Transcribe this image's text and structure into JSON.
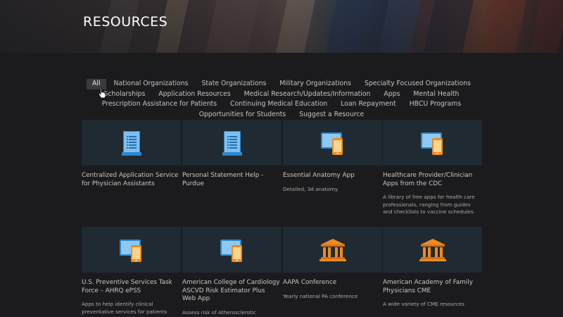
{
  "header": {
    "title": "RESOURCES"
  },
  "filters": [
    "All",
    "National Organizations",
    "State Organizations",
    "Military Organizations",
    "Specialty Focused Organizations",
    "Scholarships",
    "Application Resources",
    "Medical Research/Updates/Information",
    "Apps",
    "Mental Health",
    "Prescription Assistance for Patients",
    "Continuing Medical Education",
    "Loan Repayment",
    "HBCU Programs",
    "Opportunities for Students",
    "Suggest a Resource"
  ],
  "active_filter": "All",
  "cards": [
    {
      "icon": "document-icon",
      "title": "Centralized Application Service for Physician Assistants",
      "desc": ""
    },
    {
      "icon": "document-icon",
      "title": "Personal Statement Help - Purdue",
      "desc": ""
    },
    {
      "icon": "devices-icon",
      "title": "Essential Anatomy App",
      "desc": "Detailed, 3d anatomy."
    },
    {
      "icon": "devices-icon",
      "title": "Healthcare Provider/Clinician Apps from the CDC",
      "desc": "A library of free apps for health care professionals, ranging from guides and checklists to vaccine schedules."
    },
    {
      "icon": "devices-icon",
      "title": "U.S. Preventive Services Task Force – AHRQ ePSS",
      "desc": "Apps to help identify clinical preventative services for patients"
    },
    {
      "icon": "devices-icon",
      "title": "American College of Cardiology ASCVD Risk Estimator Plus Web App",
      "desc": "Assess risk of Atherosclerotic Cardiovascular Disease"
    },
    {
      "icon": "institution-icon",
      "title": "AAPA Conference",
      "desc": "Yearly national PA conference"
    },
    {
      "icon": "institution-icon",
      "title": "American Academy of Family Physicians CME",
      "desc": "A wide variety of CME resources"
    }
  ]
}
